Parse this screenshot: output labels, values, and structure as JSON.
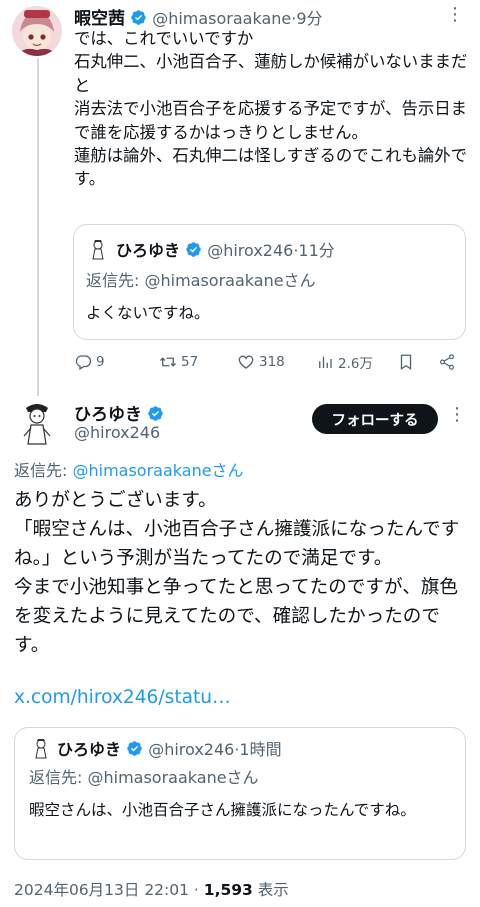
{
  "colors": {
    "accent": "#1d9bf0",
    "text": "#0f1419",
    "secondary": "#536471",
    "border": "#cfd9de"
  },
  "tweet1": {
    "name": "暇空茜",
    "handle": "@himasoraakane",
    "time": "9分",
    "text": "では、これでいいですか\n石丸伸二、小池百合子、蓮舫しか候補がいないままだと\n消去法で小池百合子を応援する予定ですが、告示日まで誰を応援するかはっきりとしません。\n蓮舫は論外、石丸伸二は怪しすぎるのでこれも論外です。",
    "quote": {
      "name": "ひろゆき",
      "handle": "@hirox246",
      "time": "11分",
      "reply_to_label": "返信先: ",
      "reply_to_handle": "@himasoraakane",
      "reply_to_suffix": "さん",
      "text": "よくないですね。"
    },
    "actions": {
      "replies": "9",
      "retweets": "57",
      "likes": "318",
      "views": "2.6万"
    }
  },
  "tweet2": {
    "name": "ひろゆき",
    "handle": "@hirox246",
    "follow_label": "フォローする",
    "reply_to_label": "返信先: ",
    "reply_to_handle": "@himasoraakane",
    "reply_to_suffix": "さん",
    "text": "ありがとうございます。\n「暇空さんは、小池百合子さん擁護派になったんですね。」という予測が当たってたので満足です。\n今まで小池知事と争ってたと思ってたのですが、旗色を変えたように見えてたので、確認したかったのです。",
    "link": "x.com/hirox246/statu…",
    "quote": {
      "name": "ひろゆき",
      "handle": "@hirox246",
      "time": "1時間",
      "reply_to_label": "返信先: ",
      "reply_to_handle": "@himasoraakane",
      "reply_to_suffix": "さん",
      "text": "暇空さんは、小池百合子さん擁護派になったんですね。"
    },
    "date": "2024年06月13日 22:01",
    "views_count": "1,593",
    "views_label": "表示"
  }
}
